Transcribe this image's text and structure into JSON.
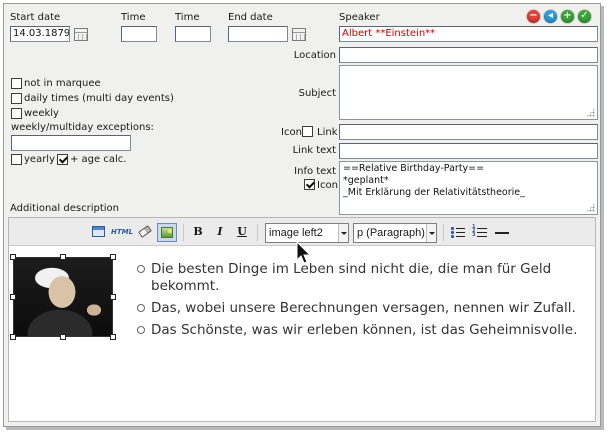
{
  "form": {
    "start_date_label": "Start date",
    "start_date_value": "14.03.1879",
    "time1_label": "Time",
    "time1_value": "",
    "time2_label": "Time",
    "time2_value": "",
    "end_date_label": "End date",
    "end_date_value": "",
    "speaker_label": "Speaker",
    "speaker_value": "Albert **Einstein**",
    "location_label": "Location",
    "location_value": "",
    "subject_label": "Subject",
    "subject_value": "",
    "icon_label": "Icon",
    "link_label": "Link",
    "link_value": "",
    "link_text_label": "Link text",
    "link_text_value": "",
    "info_text_label": "Info text",
    "info_icon_label": "Icon",
    "info_text_lines": [
      "==Relative Birthday-Party==",
      "*geplant*",
      "_Mit Erklärung der Relativitätstheorie_"
    ],
    "not_in_marquee_label": "not in marquee",
    "daily_times_label": "daily times (multi day events)",
    "weekly_label": "weekly",
    "exceptions_label": "weekly/multiday exceptions:",
    "exceptions_value": "",
    "yearly_label": "yearly",
    "age_calc_label": "+ age calc.",
    "additional_description_label": "Additional description"
  },
  "checkboxes": {
    "not_in_marquee": false,
    "daily_times": false,
    "weekly": false,
    "yearly": false,
    "age_calc": true,
    "icon_link": false,
    "info_icon": true
  },
  "action_icons": [
    {
      "name": "remove-icon",
      "color": "#e0413a",
      "glyph": "−"
    },
    {
      "name": "previous-icon",
      "color": "#2f9bd6",
      "glyph": "◂"
    },
    {
      "name": "add-icon",
      "color": "#3aa537",
      "glyph": "+"
    },
    {
      "name": "confirm-icon",
      "color": "#3aa537",
      "glyph": "✓"
    }
  ],
  "toolbar": {
    "html_label": "HTML",
    "bold_label": "B",
    "italic_label": "I",
    "underline_label": "U",
    "image_style_value": "image left2",
    "paragraph_value": "p (Paragraph)"
  },
  "editor": {
    "quotes": [
      "Die besten Dinge im Leben sind nicht die, die man für Geld bekommt.",
      "Das, wobei unsere Berechnungen versagen, nennen wir Zufall.",
      "Das Schönste, was wir erleben können, ist das Geheimnisvolle."
    ]
  },
  "colors": {
    "speaker_text": "#cc0000",
    "panel_bg": "#f0f0ef",
    "toolbar_bg": "#ebebeb"
  }
}
